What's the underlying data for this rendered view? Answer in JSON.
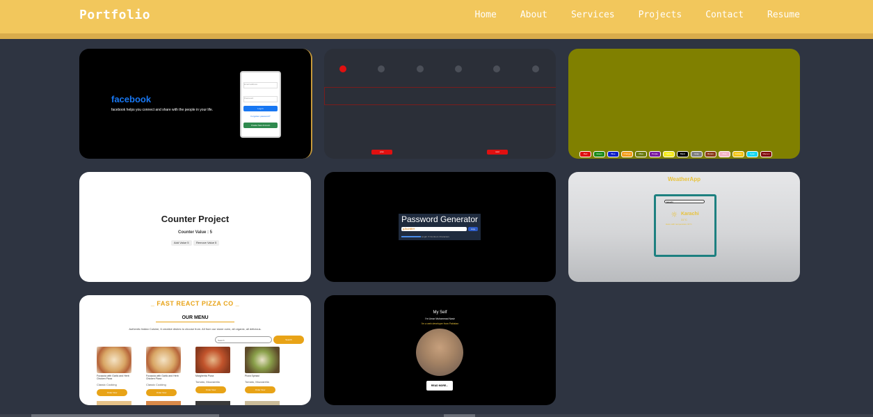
{
  "header": {
    "brand": "Portfolio",
    "nav": [
      "Home",
      "About",
      "Services",
      "Projects",
      "Contact",
      "Resume"
    ]
  },
  "projects": {
    "facebook": {
      "logo": "facebook",
      "tagline": "facebook helps you connect and share with the people in your life.",
      "email_placeholder": "Email address",
      "password_placeholder": "Password",
      "login": "Log in",
      "forgot": "Forgotten password?",
      "create": "Create New Account"
    },
    "stepper": {
      "prev": "prev",
      "next": "next"
    },
    "color_switcher": {
      "colors": [
        {
          "name": "Red",
          "hex": "#e01010"
        },
        {
          "name": "Green",
          "hex": "#1a8a1a"
        },
        {
          "name": "Blue",
          "hex": "#1020c8"
        },
        {
          "name": "Orange",
          "hex": "#f29b18"
        },
        {
          "name": "Olive",
          "hex": "#6b7a12"
        },
        {
          "name": "Purple",
          "hex": "#7a1aa0"
        },
        {
          "name": "Yellow",
          "hex": "#f4e81a"
        },
        {
          "name": "Black",
          "hex": "#000000"
        },
        {
          "name": "Gray",
          "hex": "#808080"
        },
        {
          "name": "Brown",
          "hex": "#8b3a1a"
        },
        {
          "name": "Pink",
          "hex": "#f4b6c6"
        },
        {
          "name": "Golden",
          "hex": "#f2c416"
        },
        {
          "name": "Cyan",
          "hex": "#17d7f0"
        },
        {
          "name": "Maroon",
          "hex": "#800000"
        }
      ]
    },
    "counter": {
      "title": "Counter Project",
      "value_label": "Counter Value : 5",
      "add": "Add Value 5",
      "remove": "Remove Value 5"
    },
    "password": {
      "title": "Password Generator",
      "value": "gJkuhBtH",
      "copy": "copy",
      "length": "length: 8",
      "numbers": "Numbers",
      "characters": "Characters"
    },
    "weather": {
      "title": "WeatherApp",
      "search": "karachi",
      "city": "Karachi",
      "temp": "31°C",
      "desc": "Haze with temperature 31°C"
    },
    "pizza": {
      "title": "_ FAST REACT PIZZA CO _",
      "menu": "OUR MENU",
      "desc": "Authentic Italian Cuisine, 6 creative dishes to choose from. All from our stone oven, all organic, all delicious.",
      "search_placeholder": "Search",
      "search_btn": "Search",
      "items": [
        {
          "name": "Focaccia with Garlic and Herb Chicken Pizza",
          "tag": "Classic Cooking",
          "btn": "Order Now"
        },
        {
          "name": "Focaccia with Garlic and Herb Chicken Pizza",
          "tag": "Classic Cooking",
          "btn": "Order Now"
        },
        {
          "name": "Margherita Pizza",
          "tag": "Tomato, Mozzarella",
          "btn": "Order Now"
        },
        {
          "name": "Pizza Spinaci",
          "tag": "Tomato, Mozzarella",
          "btn": "Order Now"
        }
      ]
    },
    "myself": {
      "title": "My Self",
      "name": "I'm Umar Muhammad Nasir",
      "role": "I'm a web developer from Pakistan",
      "btn": "READ MORE..."
    }
  }
}
